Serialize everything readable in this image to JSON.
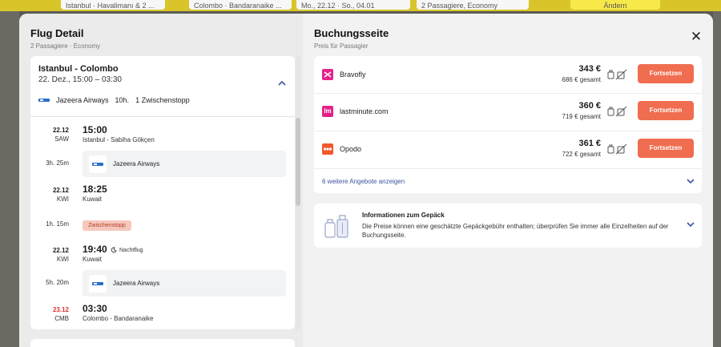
{
  "topbar": {
    "fields": [
      "Istanbul · Havalimanı & 2 ...",
      "Colombo · Bandaranaike ...",
      "Mo., 22.12 · So., 04.01",
      "2 Passagiere, Economy",
      "Ändern"
    ]
  },
  "left": {
    "title": "Flug Detail",
    "subtitle": "2 Passagiere · Economy",
    "route": "Istanbul - Colombo",
    "route_time": "22. Dez.,    15:00 – 03:30",
    "airline": "Jazeera Airways",
    "duration": "10h.",
    "stops": "1 Zwischenstopp",
    "segments": {
      "s1_date": "22.12",
      "s1_code": "SAW",
      "s1_time": "15:00",
      "s1_place": "Istanbul - Sabiha Gökçen",
      "leg1_dur": "3h. 25m",
      "leg1_airline": "Jazeera Airways",
      "s2_date": "22.12",
      "s2_code": "KWI",
      "s2_time": "18:25",
      "s2_place": "Kuwait",
      "stop_dur": "1h. 15m",
      "stop_label": "Zwischenstopp",
      "s3_date": "22.12",
      "s3_code": "KWI",
      "s3_time": "19:40",
      "s3_night": "Nachtflug",
      "s3_place": "Kuwait",
      "leg2_dur": "5h. 20m",
      "leg2_airline": "Jazeera Airways",
      "s4_date": "23.12",
      "s4_code": "CMB",
      "s4_time": "03:30",
      "s4_place": "Colombo - Bandaranaike"
    }
  },
  "right": {
    "title": "Buchungsseite",
    "subtitle": "Preis für Passagier",
    "offers": [
      {
        "name": "Bravofly",
        "price": "343 €",
        "total": "686 € gesamt",
        "cta": "Fortsetzen",
        "color": "#e6218a"
      },
      {
        "name": "lastminute.com",
        "price": "360 €",
        "total": "719 € gesamt",
        "cta": "Fortsetzen",
        "color": "#e6218a"
      },
      {
        "name": "Opodo",
        "price": "361 €",
        "total": "722 € gesamt",
        "cta": "Fortsetzen",
        "color": "#f2572c"
      }
    ],
    "more_offers": "6 weitere Angebote anzeigen",
    "baggage_title": "Informationen zum Gepäck",
    "baggage_text": "Die Preise können eine geschätzte Gepäckgebühr enthalten; überprüfen Sie immer alle Einzelheiten auf der Buchungsseite."
  },
  "colors": {
    "accent": "#f06d4f",
    "link": "#3b56a0",
    "topbar": "#d9c52a"
  }
}
